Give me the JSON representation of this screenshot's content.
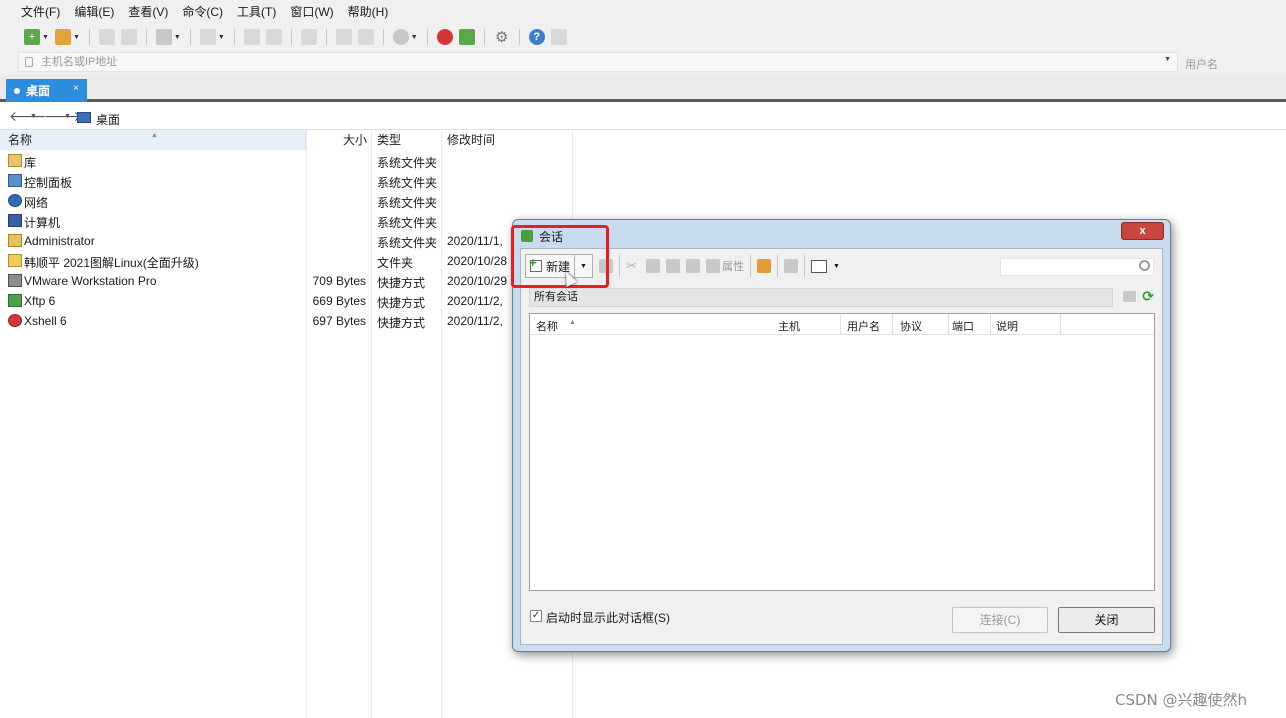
{
  "menu": [
    "文件(F)",
    "编辑(E)",
    "查看(V)",
    "命令(C)",
    "工具(T)",
    "窗口(W)",
    "帮助(H)"
  ],
  "address_bar": {
    "host_placeholder": "主机名或IP地址",
    "user_placeholder": "用户名"
  },
  "tabs": [
    {
      "label": "桌面",
      "close": "×",
      "active": true
    }
  ],
  "nav": {
    "path": "桌面"
  },
  "file_list": {
    "columns": {
      "name": "名称",
      "size": "大小",
      "type": "类型",
      "modified": "修改时间"
    },
    "rows": [
      {
        "name": "库",
        "size": "",
        "type": "系统文件夹",
        "modified": "",
        "icon": "library-icon"
      },
      {
        "name": "控制面板",
        "size": "",
        "type": "系统文件夹",
        "modified": "",
        "icon": "control-panel-icon"
      },
      {
        "name": "网络",
        "size": "",
        "type": "系统文件夹",
        "modified": "",
        "icon": "network-icon"
      },
      {
        "name": "计算机",
        "size": "",
        "type": "系统文件夹",
        "modified": "",
        "icon": "computer-icon"
      },
      {
        "name": "Administrator",
        "size": "",
        "type": "系统文件夹",
        "modified": "2020/11/1,",
        "icon": "user-folder-icon"
      },
      {
        "name": "韩顺平 2021图解Linux(全面升级)",
        "size": "",
        "type": "文件夹",
        "modified": "2020/10/28",
        "icon": "folder-icon"
      },
      {
        "name": "VMware Workstation Pro",
        "size": "709 Bytes",
        "type": "快捷方式",
        "modified": "2020/10/29",
        "icon": "vmware-icon"
      },
      {
        "name": "Xftp 6",
        "size": "669 Bytes",
        "type": "快捷方式",
        "modified": "2020/11/2,",
        "icon": "xftp-icon"
      },
      {
        "name": "Xshell 6",
        "size": "697 Bytes",
        "type": "快捷方式",
        "modified": "2020/11/2,",
        "icon": "xshell-icon"
      }
    ]
  },
  "session_dialog": {
    "title": "会话",
    "close_glyph": "x",
    "toolbar": {
      "new_label": "新建",
      "properties_label": "属性"
    },
    "filter_label": "所有会话",
    "columns": {
      "name": "名称",
      "host": "主机",
      "user": "用户名",
      "protocol": "协议",
      "port": "端口",
      "description": "说明"
    },
    "sessions": [],
    "show_on_startup_label": "启动时显示此对话框(S)",
    "show_on_startup_checked": true,
    "connect_label": "连接(C)",
    "close_label": "关闭"
  },
  "watermark": "CSDN @兴趣使然h",
  "colors": {
    "tab_active": "#2d8ee0",
    "highlight_box": "#ee1c1c",
    "dialog_close": "#c9463d"
  }
}
